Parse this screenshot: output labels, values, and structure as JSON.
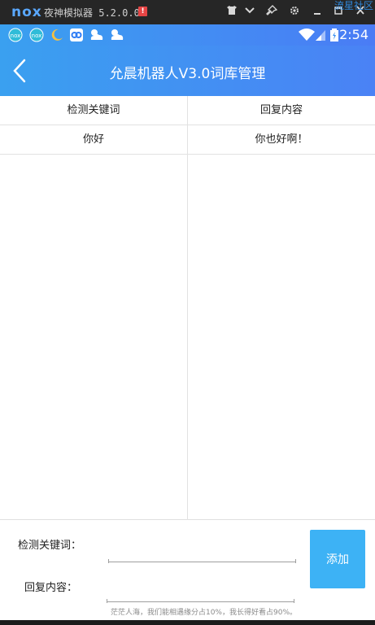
{
  "emulator": {
    "logo": "nox",
    "title": "夜神模拟器 5.2.0.0",
    "alert": "!",
    "watermark": "流星社区",
    "controls": [
      "shirt-icon",
      "chevron-down-icon",
      "pin-icon",
      "gear-icon",
      "minimize-icon",
      "maximize-icon",
      "close-icon"
    ]
  },
  "status_bar": {
    "time": "2:54",
    "left_icons": [
      "nox-app-icon",
      "nox-app-icon-2",
      "moon-icon",
      "baidu-icon",
      "weather-cloud-icon",
      "weather-cloud-icon-2"
    ],
    "right_icons": [
      "wifi-icon",
      "signal-icon",
      "battery-icon"
    ]
  },
  "app_bar": {
    "title": "允晨机器人V3.0词库管理"
  },
  "table": {
    "headers": [
      "检测关键词",
      "回复内容"
    ],
    "rows": [
      {
        "keyword": "你好",
        "reply": "你也好啊！"
      }
    ]
  },
  "form": {
    "keyword_label": "检测关键词：",
    "keyword_value": "",
    "reply_label": "回复内容：",
    "reply_value": "",
    "add_label": "添加",
    "footer_note": "茫茫人海，我们能相遇缘分占10%，我长得好看占90%。"
  },
  "colors": {
    "accent": "#3db2f5",
    "header_gradient_start": "#3aa0f0",
    "header_gradient_end": "#4a82f5"
  }
}
